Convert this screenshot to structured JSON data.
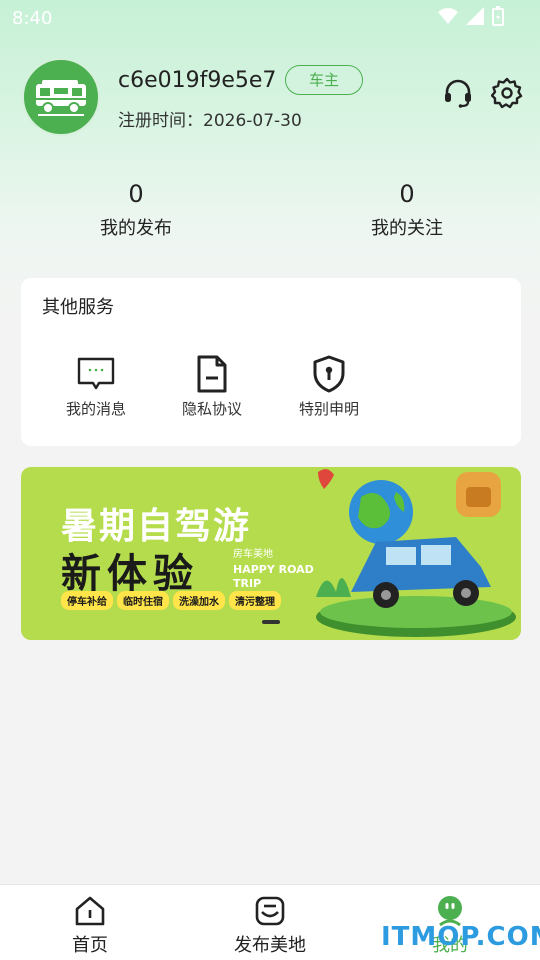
{
  "status_bar": {
    "time": "8:40"
  },
  "profile": {
    "username": "c6e019f9e5e7",
    "role_badge": "车主",
    "registered_label": "注册时间：",
    "registered_date": "2026-07-30",
    "support_icon": "headset-icon",
    "settings_icon": "gear-icon"
  },
  "stats": [
    {
      "value": "0",
      "label": "我的发布"
    },
    {
      "value": "0",
      "label": "我的关注"
    }
  ],
  "services": {
    "title": "其他服务",
    "items": [
      {
        "label": "我的消息",
        "icon": "message-icon"
      },
      {
        "label": "隐私协议",
        "icon": "document-icon"
      },
      {
        "label": "特别申明",
        "icon": "shield-icon"
      }
    ]
  },
  "banner": {
    "title": "暑期自驾游",
    "subtitle": "新体验",
    "brand": "房车美地",
    "tagline": "HAPPY ROAD TRIP",
    "tags": [
      "停车补给",
      "临时住宿",
      "洗澡加水",
      "清污整理"
    ]
  },
  "tabbar": {
    "items": [
      {
        "label": "首页",
        "icon": "home-icon",
        "active": false
      },
      {
        "label": "发布美地",
        "icon": "publish-icon",
        "active": false
      },
      {
        "label": "我的",
        "icon": "mine-icon",
        "active": true
      }
    ]
  },
  "watermark": "ITMOP.COM",
  "colors": {
    "accent": "#4caf50",
    "background": "#f3f3f3",
    "banner": "#b5dc4c"
  }
}
